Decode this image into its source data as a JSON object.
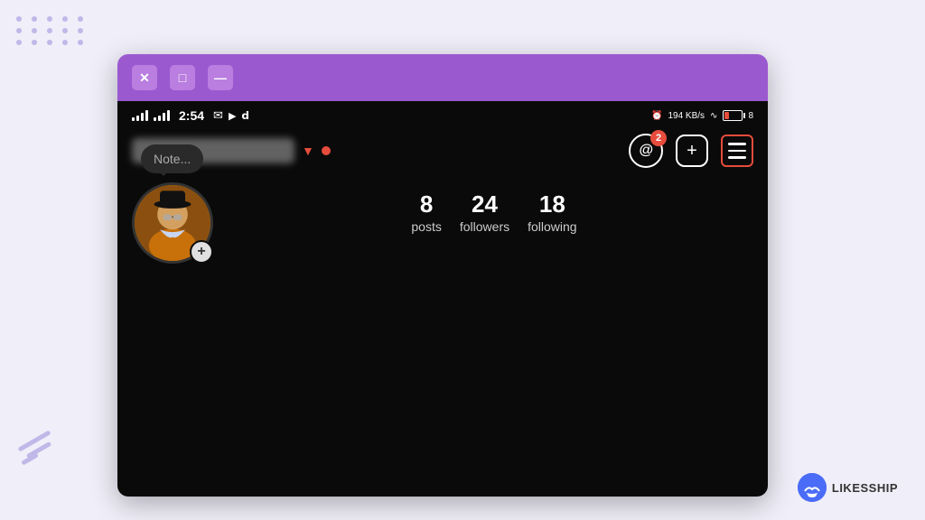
{
  "window": {
    "title_bar": {
      "close_label": "✕",
      "maximize_label": "□",
      "minimize_label": "—"
    }
  },
  "status_bar": {
    "time": "2:54",
    "signal1": "signal",
    "signal2": "signal",
    "kb_speed": "194 KB/s",
    "battery_level": "8"
  },
  "nav": {
    "username_placeholder": "blurred username",
    "threads_badge": "2",
    "add_icon_label": "+",
    "menu_label": "menu"
  },
  "note_bubble": {
    "text": "Note..."
  },
  "stats": [
    {
      "number": "8",
      "label": "posts"
    },
    {
      "number": "24",
      "label": "followers"
    },
    {
      "number": "18",
      "label": "following"
    }
  ],
  "avatar": {
    "add_button": "+"
  },
  "logo": {
    "text": "LIKESSHIP"
  },
  "dots": [
    1,
    2,
    3,
    4,
    5,
    6,
    7,
    8,
    9,
    10,
    11,
    12,
    13,
    14,
    15
  ]
}
